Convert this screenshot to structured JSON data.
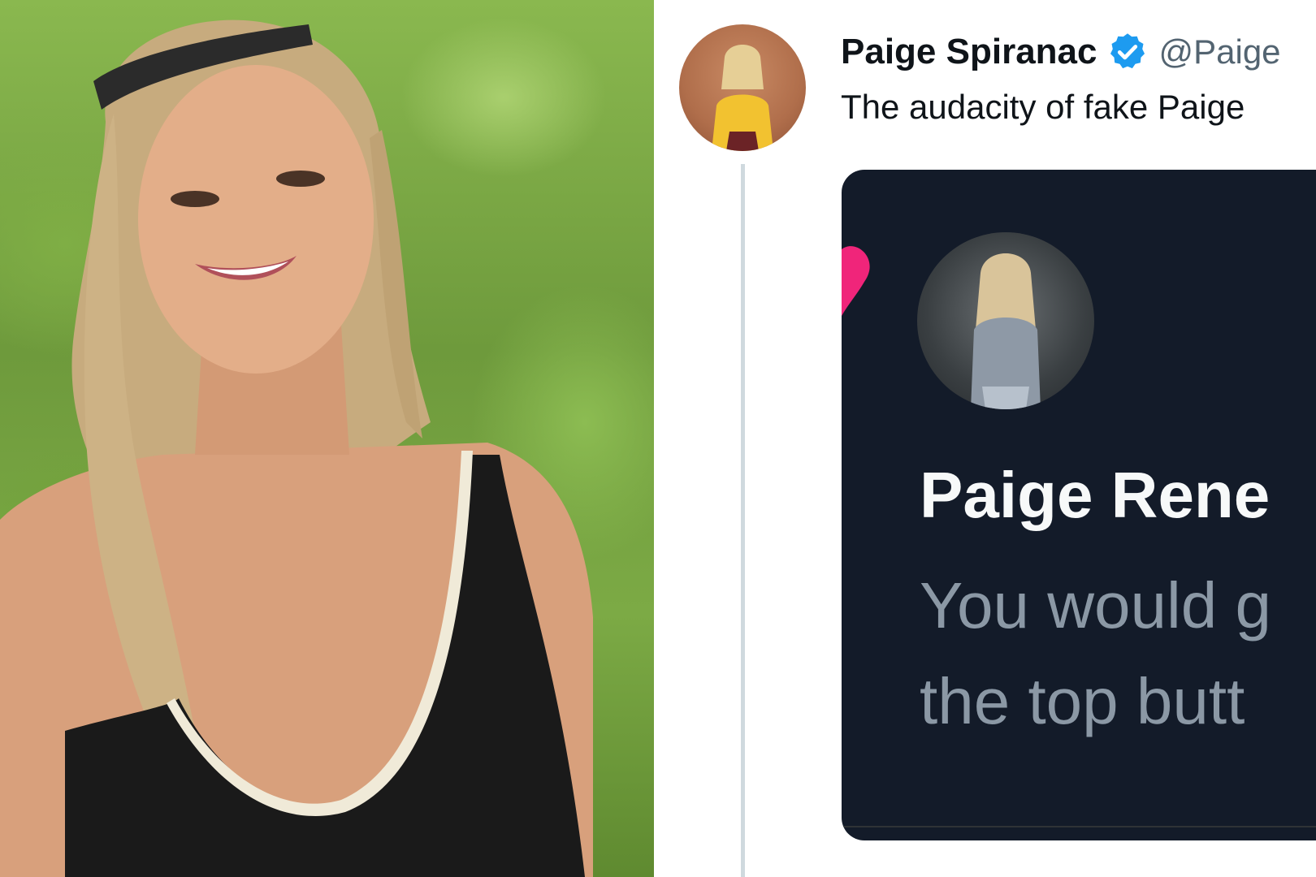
{
  "photo": {
    "alt": "Woman smiling outdoors in front of green foliage"
  },
  "tweet": {
    "author_name": "Paige Spiranac",
    "verified_icon": "verified-badge-icon",
    "handle": "@Paige",
    "text": "The audacity of fake Paige"
  },
  "quoted": {
    "name": "Paige Rene",
    "text_line1": "You would g",
    "text_line2": "the top butt"
  },
  "colors": {
    "verified": "#1d9bf0",
    "card_bg": "#131b29",
    "heart": "#f0257a"
  }
}
